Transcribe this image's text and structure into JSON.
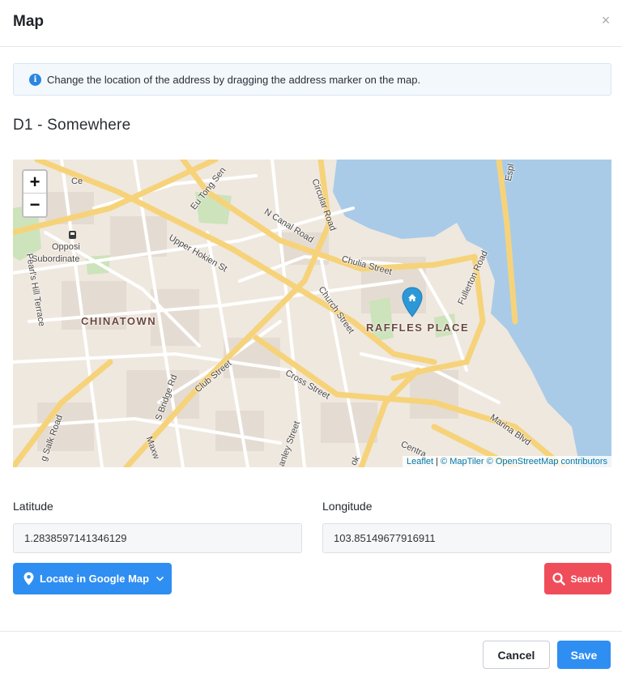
{
  "modal": {
    "title": "Map",
    "close_icon": "close-icon"
  },
  "info": {
    "icon": "info-icon",
    "text": "Change the location of the address by dragging the address marker on the map."
  },
  "address": {
    "title": "D1 - Somewhere"
  },
  "map": {
    "zoom_in": "+",
    "zoom_out": "−",
    "areas": [
      "CHINATOWN",
      "RAFFLES PLACE"
    ],
    "streets": [
      "Eu Tong Sen",
      "N Canal Road",
      "Circular Road",
      "Chulia Street",
      "Upper Hokien St",
      "Church Street",
      "Fullerton Road",
      "Cross Street",
      "Club Street",
      "S Bridge Rd",
      "Marina Blvd",
      "Pearl's Hill Terrace",
      "Opposi",
      "Subordinate",
      "Ce",
      "Espl",
      "Centra",
      "anley Street",
      "g Salk Road",
      "Maxw",
      "ok"
    ],
    "marker_icon": "map-marker-icon",
    "attribution": {
      "leaflet": "Leaflet",
      "separator": " | ",
      "maptiler": "© MapTiler",
      "osm": "© OpenStreetMap contributors"
    }
  },
  "latitude": {
    "label": "Latitude",
    "value": "1.2838597141346129"
  },
  "longitude": {
    "label": "Longitude",
    "value": "103.85149677916911"
  },
  "buttons": {
    "google_map": "Locate in Google Map",
    "search": "Search",
    "cancel": "Cancel",
    "save": "Save"
  },
  "colors": {
    "primary": "#2f8ef2",
    "danger": "#f04d5b",
    "water": "#a9cbe8",
    "road_major": "#f6d37a",
    "park": "#cfe3bd",
    "marker": "#2c98d8"
  }
}
